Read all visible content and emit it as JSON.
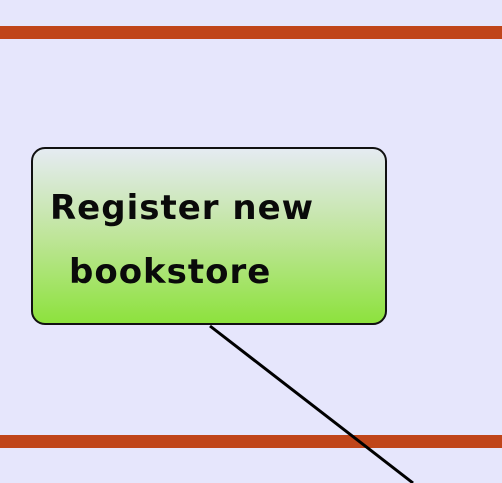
{
  "diagram": {
    "colors": {
      "background": "#e6e6fc",
      "lane_divider": "#c0451a",
      "connector": "#000000",
      "node_border": "#111111",
      "node_fill_top": "#e5ebf2",
      "node_fill_bottom": "#8de23d"
    },
    "node": {
      "label_lines": [
        "Register new",
        "bookstore"
      ]
    }
  }
}
